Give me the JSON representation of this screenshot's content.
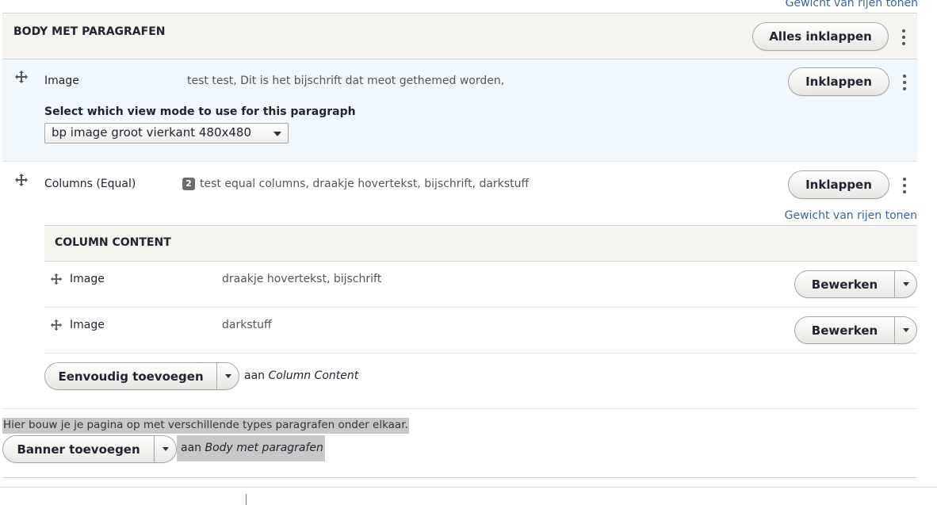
{
  "top_weight_link": "Gewicht van rijen tonen",
  "header": {
    "title": "BODY MET PARAGRAFEN",
    "collapse_all_label": "Alles inklappen"
  },
  "paragraph_image": {
    "type": "Image",
    "summary": "test test, Dit is het bijschrift dat meot gethemed worden,",
    "collapse_label": "Inklappen",
    "view_mode_label": "Select which view mode to use for this paragraph",
    "view_mode_value": "bp image groot vierkant 480x480"
  },
  "paragraph_columns": {
    "type": "Columns (Equal)",
    "badge_count": "2",
    "summary": "test equal columns, draakje hovertekst, bijschrift, darkstuff",
    "collapse_label": "Inklappen",
    "weight_link": "Gewicht van rijen tonen"
  },
  "column_content": {
    "title": "COLUMN CONTENT",
    "rows": [
      {
        "type": "Image",
        "summary": "draakje hovertekst, bijschrift",
        "edit_label": "Bewerken"
      },
      {
        "type": "Image",
        "summary": "darkstuff",
        "edit_label": "Bewerken"
      }
    ],
    "add_label": "Eenvoudig toevoegen",
    "add_to_prefix": "aan",
    "add_to_target": "Column Content"
  },
  "footer": {
    "help_text": "Hier bouw je je pagina op met verschillende types paragrafen onder elkaar.",
    "add_label": "Banner toevoegen",
    "add_to_prefix": "aan",
    "add_to_target": "Body met paragrafen"
  },
  "icons": {
    "drag": "drag-handle-icon",
    "kebab": "more-actions-icon",
    "dropdown": "chevron-down-icon"
  },
  "colors": {
    "link": "#3b63a6",
    "header_bg": "#f5f4ee",
    "active_row_bg": "#f1f8fd",
    "highlight_bg": "#c8c8c8"
  }
}
